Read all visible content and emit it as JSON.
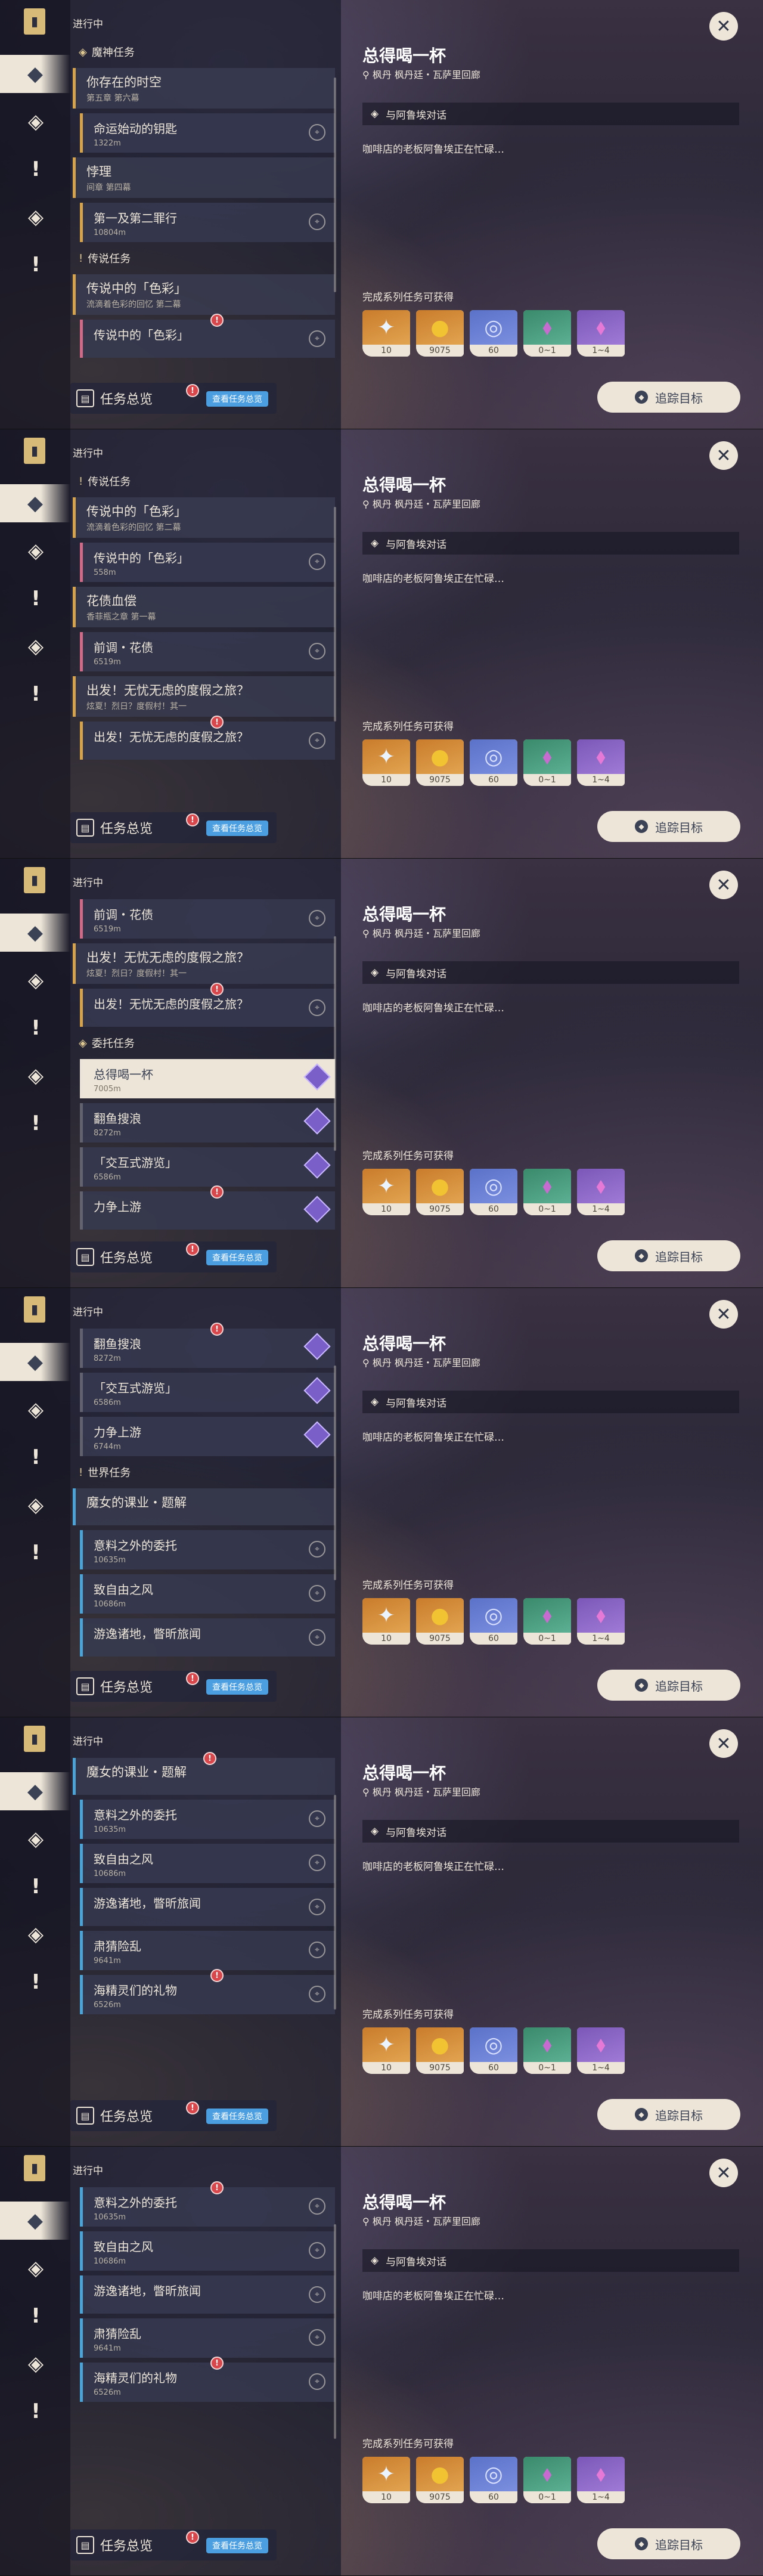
{
  "list_header": "进行中",
  "overview": {
    "label": "任务总览",
    "pill": "查看任务总览",
    "badge": "!"
  },
  "detail": {
    "title": "总得喝一杯",
    "location": "枫丹 枫丹廷・瓦萨里回廊",
    "step": "与阿鲁埃对话",
    "description": "咖啡店的老板阿鲁埃正在忙碌…",
    "reward_label": "完成系列任务可获得",
    "rewards": [
      {
        "icon": "primogem-icon",
        "qty": "10",
        "style": "r-orange"
      },
      {
        "icon": "mora-icon",
        "qty": "9075",
        "style": "r-orange"
      },
      {
        "icon": "adventure-exp-icon",
        "qty": "60",
        "style": "r-blue"
      },
      {
        "icon": "crystal-green-icon",
        "qty": "0~1",
        "style": "r-green"
      },
      {
        "icon": "crystal-purple-icon",
        "qty": "1~4",
        "style": "r-purple"
      }
    ],
    "track_label": "追踪目标",
    "close_glyph": "✕"
  },
  "frames": [
    {
      "rows": [
        {
          "kind": "section",
          "icon": "◈",
          "title": "魔神任务"
        },
        {
          "kind": "parent",
          "color": "gold",
          "title": "你存在的时空",
          "sub": "第五章 第六幕"
        },
        {
          "kind": "child",
          "color": "gold",
          "title": "命运始动的钥匙",
          "dist": "1322m"
        },
        {
          "kind": "parent",
          "color": "gold",
          "title": "悖理",
          "sub": "间章 第四幕"
        },
        {
          "kind": "child",
          "color": "gold",
          "title": "第一及第二罪行",
          "dist": "10804m"
        },
        {
          "kind": "section",
          "icon": "!",
          "title": "传说任务"
        },
        {
          "kind": "parent",
          "color": "pink",
          "title": "传说中的「色彩」",
          "sub": "流滴着色彩的回忆 第二幕"
        },
        {
          "kind": "child",
          "color": "pink",
          "title": "传说中的「色彩」",
          "dist": "",
          "badge": "!"
        }
      ]
    },
    {
      "rows": [
        {
          "kind": "section",
          "icon": "!",
          "title": "传说任务"
        },
        {
          "kind": "parent",
          "color": "pink",
          "title": "传说中的「色彩」",
          "sub": "流滴着色彩的回忆 第二幕"
        },
        {
          "kind": "child",
          "color": "pink",
          "title": "传说中的「色彩」",
          "dist": "558m"
        },
        {
          "kind": "parent",
          "color": "pink",
          "title": "花债血偿",
          "sub": "香菲瓶之章 第一幕"
        },
        {
          "kind": "child",
          "color": "pink",
          "title": "前调・花债",
          "dist": "6519m"
        },
        {
          "kind": "parent",
          "color": "gold",
          "title": "出发！无忧无虑的度假之旅？",
          "sub": "炫夏！烈日？度假村！其一"
        },
        {
          "kind": "child",
          "color": "gold",
          "title": "出发！无忧无虑的度假之旅？",
          "dist": "",
          "badge": "!"
        }
      ]
    },
    {
      "rows": [
        {
          "kind": "child",
          "color": "pink",
          "title": "前调・花债",
          "dist": "6519m"
        },
        {
          "kind": "parent",
          "color": "gold",
          "title": "出发！无忧无虑的度假之旅？",
          "sub": "炫夏！烈日？度假村！其一"
        },
        {
          "kind": "child",
          "color": "gold",
          "title": "出发！无忧无虑的度假之旅？",
          "dist": "",
          "badge": "!"
        },
        {
          "kind": "section",
          "icon": "◈",
          "title": "委托任务"
        },
        {
          "kind": "child",
          "color": "purple",
          "title": "总得喝一杯",
          "dist": "7005m",
          "selected": true,
          "prio": true
        },
        {
          "kind": "child",
          "color": "purple",
          "title": "翻鱼搜浪",
          "dist": "8272m",
          "prio": true
        },
        {
          "kind": "child",
          "color": "purple",
          "title": "「交互式游览」",
          "dist": "6586m",
          "prio": true
        },
        {
          "kind": "child",
          "color": "purple",
          "title": "力争上游",
          "dist": "",
          "prio": true,
          "badge": "!"
        }
      ]
    },
    {
      "rows": [
        {
          "kind": "child",
          "color": "purple",
          "title": "翻鱼搜浪",
          "dist": "8272m",
          "prio": true,
          "badge": "!"
        },
        {
          "kind": "child",
          "color": "purple",
          "title": "「交互式游览」",
          "dist": "6586m",
          "prio": true
        },
        {
          "kind": "child",
          "color": "purple",
          "title": "力争上游",
          "dist": "6744m",
          "prio": true
        },
        {
          "kind": "section",
          "icon": "!",
          "title": "世界任务"
        },
        {
          "kind": "parent",
          "color": "blue",
          "title": "魔女的课业・题解",
          "sub": ""
        },
        {
          "kind": "child",
          "color": "blue",
          "title": "意料之外的委托",
          "dist": "10635m"
        },
        {
          "kind": "child",
          "color": "blue",
          "title": "致自由之风",
          "dist": "10686m"
        },
        {
          "kind": "child",
          "color": "blue",
          "title": "游逸诸地，瞥昕旅闻",
          "dist": ""
        }
      ]
    },
    {
      "rows": [
        {
          "kind": "parent",
          "color": "blue",
          "title": "魔女的课业・题解",
          "sub": "",
          "badge": "!"
        },
        {
          "kind": "child",
          "color": "blue",
          "title": "意料之外的委托",
          "dist": "10635m"
        },
        {
          "kind": "child",
          "color": "blue",
          "title": "致自由之风",
          "dist": "10686m"
        },
        {
          "kind": "child",
          "color": "blue",
          "title": "游逸诸地，瞥昕旅闻",
          "dist": ""
        },
        {
          "kind": "child",
          "color": "blue",
          "title": "肃猜险乱",
          "dist": "9641m"
        },
        {
          "kind": "child",
          "color": "blue",
          "title": "海精灵们的礼物",
          "dist": "6526m",
          "badge": "!"
        }
      ]
    },
    {
      "rows": [
        {
          "kind": "child",
          "color": "blue",
          "title": "意料之外的委托",
          "dist": "10635m",
          "badge": "!"
        },
        {
          "kind": "child",
          "color": "blue",
          "title": "致自由之风",
          "dist": "10686m"
        },
        {
          "kind": "child",
          "color": "blue",
          "title": "游逸诸地，瞥昕旅闻",
          "dist": ""
        },
        {
          "kind": "child",
          "color": "blue",
          "title": "肃猜险乱",
          "dist": "9641m"
        },
        {
          "kind": "child",
          "color": "blue",
          "title": "海精灵们的礼物",
          "dist": "6526m",
          "badge": "!"
        }
      ]
    }
  ],
  "rail": [
    {
      "name": "quest-book-icon",
      "glyph": "▮"
    },
    {
      "name": "all-quests-icon",
      "glyph": "◆"
    },
    {
      "name": "archon-quest-icon",
      "glyph": "◈"
    },
    {
      "name": "legend-quest-icon",
      "glyph": "!"
    },
    {
      "name": "commission-icon",
      "glyph": "◈"
    },
    {
      "name": "world-quest-icon",
      "glyph": "!"
    }
  ]
}
